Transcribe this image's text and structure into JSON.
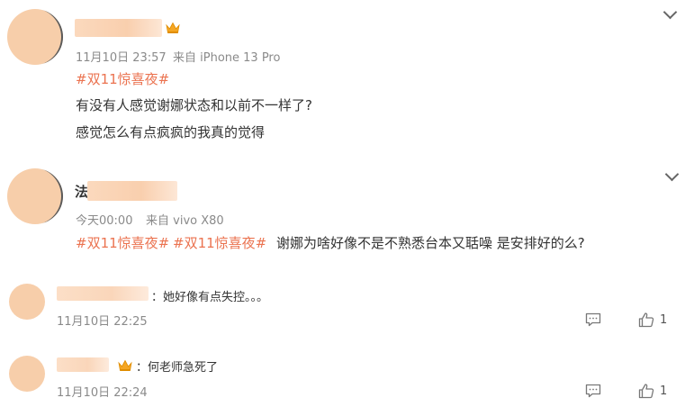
{
  "comments": [
    {
      "time": "11月10日 23:57",
      "source": "来自 iPhone 13 Pro",
      "tag": "#双11惊喜夜#",
      "line1": "有没有人感觉谢娜状态和以前不一样了?",
      "line2": "感觉怎么有点疯疯的我真的觉得"
    },
    {
      "name_visible": "法",
      "time": "今天00:00",
      "source": "来自 vivo X80",
      "tag1": "#双11惊喜夜#",
      "tag2": "#双11惊喜夜#",
      "text": "谢娜为啥好像不是不熟悉台本又聒噪 是安排好的么?"
    }
  ],
  "replies": [
    {
      "text": "：她好像有点失控。。。",
      "time": "11月10日 22:25",
      "likes": "1"
    },
    {
      "text": "：何老师急死了",
      "time": "11月10日 22:24",
      "likes": "1"
    }
  ],
  "icons": {
    "expand": "chevron-down-icon",
    "crown": "crown-icon",
    "reply": "comment-icon",
    "like": "thumbs-up-icon"
  },
  "colors": {
    "hashtag": "#eb7350",
    "avatar": "#f7ceaa",
    "meta": "#8a8a8a"
  }
}
